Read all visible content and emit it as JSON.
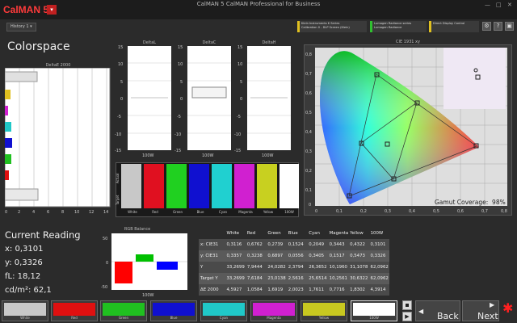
{
  "app": {
    "brand_a": "CalMAN",
    "brand_b": "5",
    "title": "CalMAN 5 CalMAN Professional for Business"
  },
  "toolbar": {
    "history_tab": "History 1",
    "devices": [
      {
        "line1": "Klein Instruments K Series",
        "line2": "Calibration 0 - DLP Screen (Klein)",
        "color": "#e0c020"
      },
      {
        "line1": "Lumagen Radiance series",
        "line2": "Lumagen Radiance",
        "color": "#30c030"
      },
      {
        "line1": "Direct Display Control",
        "line2": "",
        "color": "#e0c020"
      }
    ]
  },
  "colorspace": {
    "title": "Colorspace",
    "deltae_title": "DeltaE 2000",
    "deltae_ticks": [
      "0",
      "2",
      "4",
      "6",
      "8",
      "10",
      "12",
      "14"
    ]
  },
  "delta_charts": {
    "titles": [
      "DeltaL",
      "DeltaC",
      "DeltaH"
    ],
    "yticks": [
      "15",
      "10",
      "5",
      "0",
      "-5",
      "-10",
      "-15"
    ],
    "xlabel": "100W"
  },
  "patches": {
    "actual_label": "Actual",
    "target_label": "Target",
    "labels": [
      "White",
      "Red",
      "Green",
      "Blue",
      "Cyan",
      "Magenta",
      "Yellow",
      "100W"
    ]
  },
  "cie": {
    "title": "CIE 1931 xy",
    "gamut_label": "Gamut Coverage:",
    "gamut_value": "98%",
    "yticks": [
      "0,8",
      "0,7",
      "0,6",
      "0,5",
      "0,4",
      "0,3",
      "0,2",
      "0,1",
      "0"
    ],
    "xticks": [
      "0",
      "0,1",
      "0,2",
      "0,3",
      "0,4",
      "0,5",
      "0,6",
      "0,7",
      "0,8"
    ]
  },
  "reading": {
    "title": "Current Reading",
    "x": "x: 0,3101",
    "y": "y: 0,3326",
    "fl": "fL: 18,12",
    "cdm2": "cd/m²: 62,1"
  },
  "rgb_balance": {
    "title": "RGB Balance",
    "xlabel": "100W",
    "yticks": [
      "50",
      "0",
      "-50"
    ]
  },
  "table": {
    "headers": [
      "",
      "White",
      "Red",
      "Green",
      "Blue",
      "Cyan",
      "Magenta",
      "Yellow",
      "100W"
    ],
    "rows": [
      [
        "x: CIE31",
        "0,3116",
        "0,6762",
        "0,2739",
        "0,1524",
        "0,2049",
        "0,3443",
        "0,4322",
        "0,3101"
      ],
      [
        "y: CIE31",
        "0,3357",
        "0,3238",
        "0,6897",
        "0,0556",
        "0,3405",
        "0,1517",
        "0,5473",
        "0,3326"
      ],
      [
        "Y",
        "33,2699",
        "7,9444",
        "24,0282",
        "2,3794",
        "26,3652",
        "10,1960",
        "31,1078",
        "62,0962"
      ],
      [
        "Target Y",
        "33,2699",
        "7,6184",
        "23,0138",
        "2,5616",
        "25,6514",
        "10,2561",
        "30,6322",
        "62,0962"
      ],
      [
        "ΔE 2000",
        "4,5927",
        "1,0584",
        "1,6919",
        "2,0023",
        "1,7611",
        "0,7716",
        "1,8302",
        "4,3914"
      ]
    ]
  },
  "swatches": {
    "labels": [
      "White",
      "Red",
      "Green",
      "Blue",
      "Cyan",
      "Magenta",
      "Yellow",
      "100W"
    ],
    "colors": [
      "#c8c8c8",
      "#e01010",
      "#20c020",
      "#1010d0",
      "#20c8c8",
      "#d020d0",
      "#c8c820",
      "#ffffff"
    ]
  },
  "nav": {
    "back": "Back",
    "next": "Next"
  },
  "colors": {
    "accent": "#ff2020",
    "bg": "#2b2b2b"
  }
}
